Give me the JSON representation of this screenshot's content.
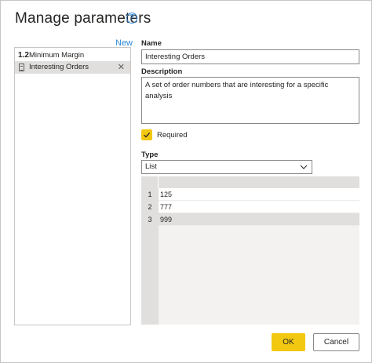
{
  "dialog": {
    "title": "Manage parameters"
  },
  "sidebar": {
    "new_label": "New",
    "items": [
      {
        "type_glyph": "1.2",
        "label": "Minimum Margin",
        "icon": "decimal-number-icon"
      },
      {
        "label": "Interesting Orders",
        "icon": "list-icon",
        "remove_glyph": "✕"
      }
    ]
  },
  "form": {
    "name_label": "Name",
    "name_value": "Interesting Orders",
    "description_label": "Description",
    "description_value": "A set of order numbers that are interesting for a specific analysis",
    "required_label": "Required",
    "required_checked": true,
    "type_label": "Type",
    "type_value": "List"
  },
  "list_grid": {
    "rows": [
      {
        "num": "1",
        "value": "125"
      },
      {
        "num": "2",
        "value": "777"
      },
      {
        "num": "3",
        "value": "999"
      }
    ]
  },
  "footer": {
    "ok_label": "OK",
    "cancel_label": "Cancel"
  },
  "colors": {
    "accent": "#f2c811",
    "link": "#2b88d8",
    "selection": "#e1dfdd"
  }
}
